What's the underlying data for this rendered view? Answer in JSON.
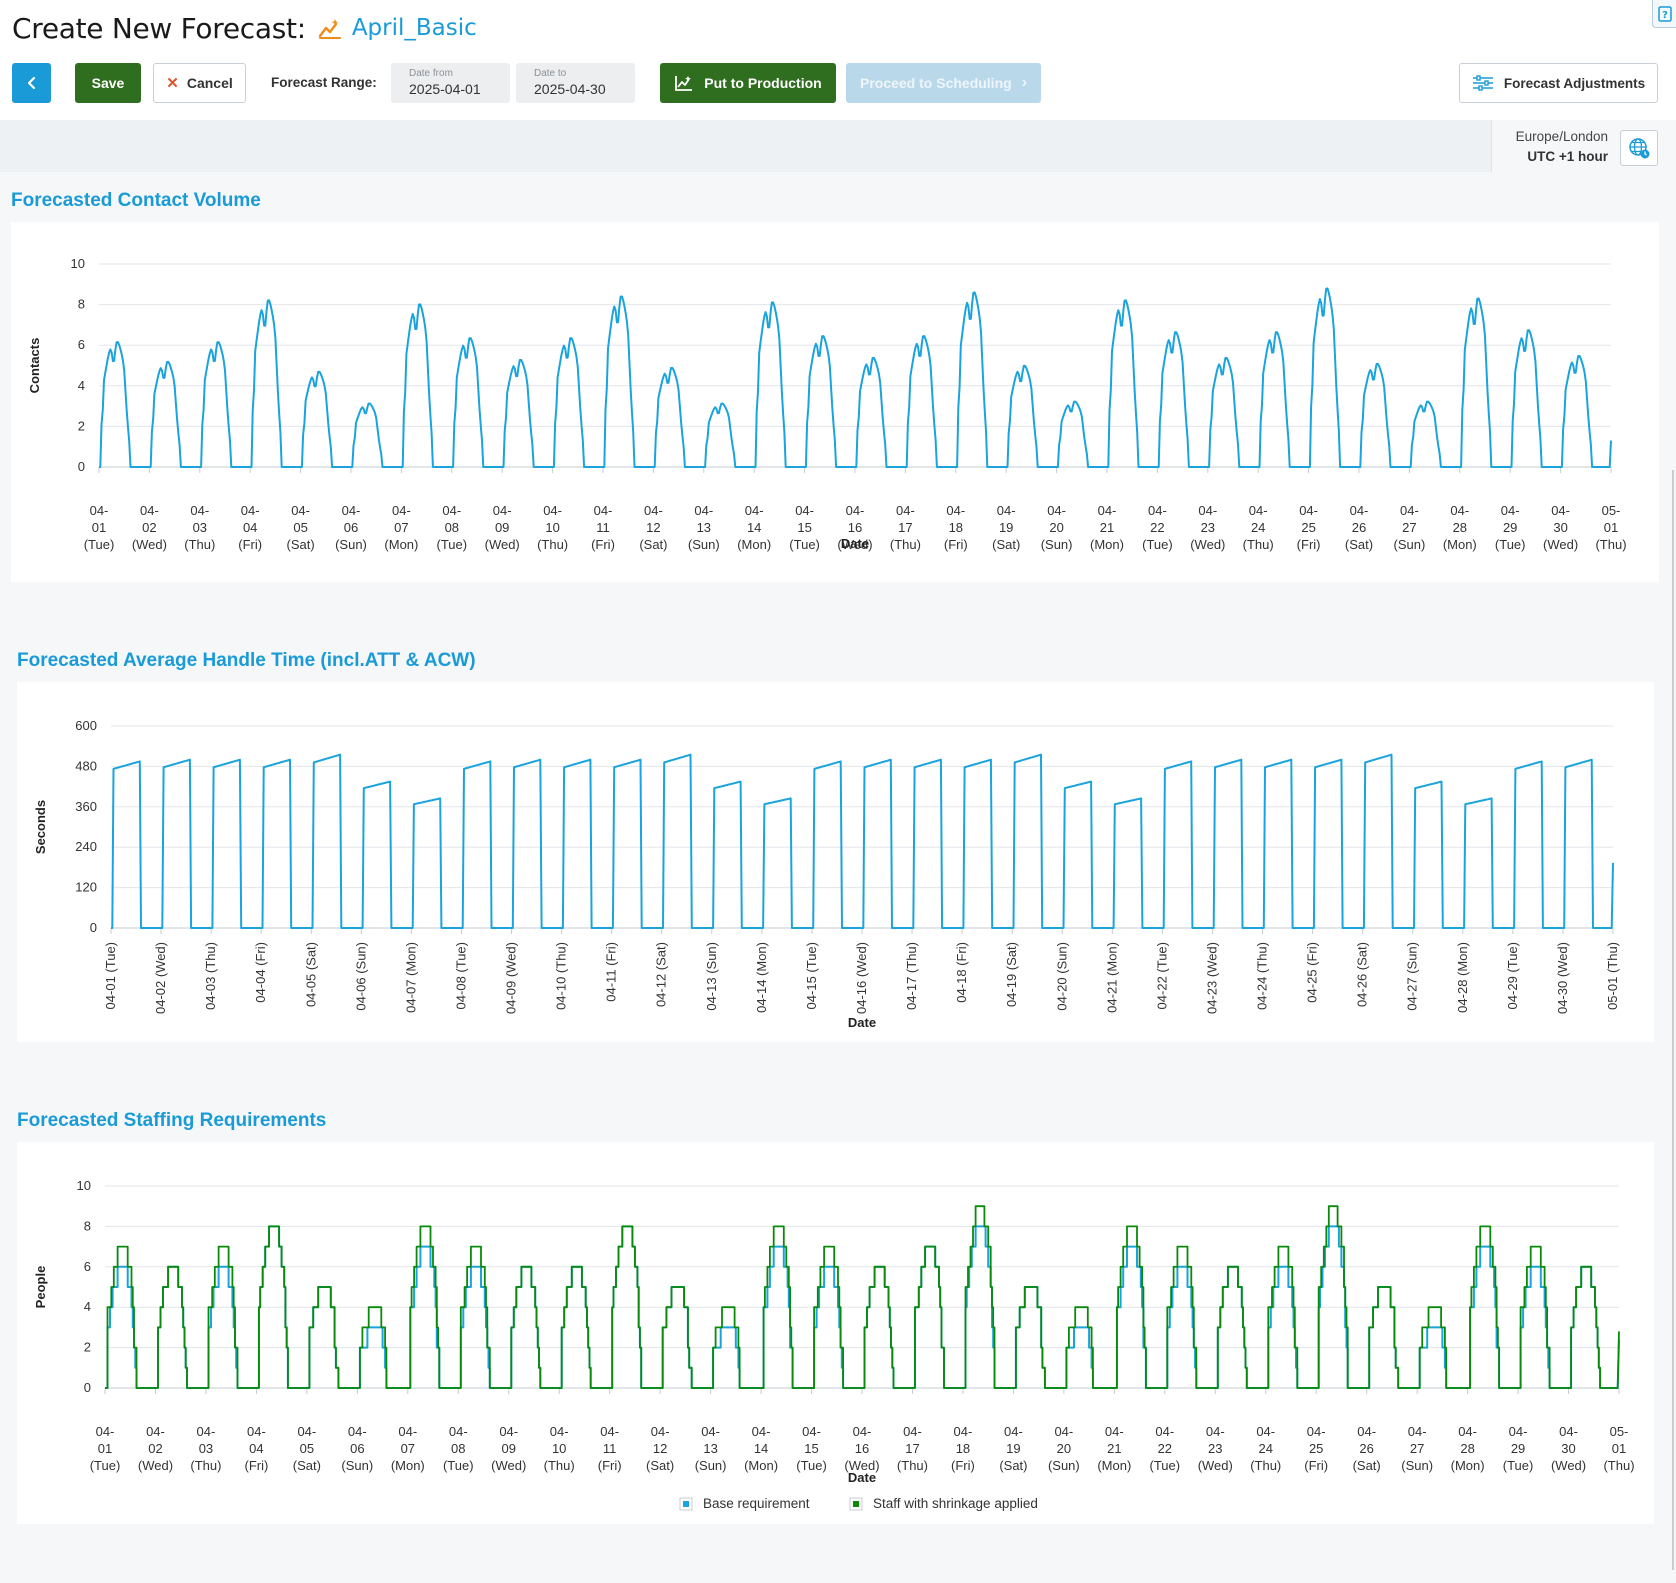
{
  "header": {
    "title": "Create New Forecast:",
    "forecast_name": "April_Basic",
    "icons": {
      "forecast": "chart-wand-icon",
      "help": "help-book-icon"
    }
  },
  "toolbar": {
    "save_label": "Save",
    "cancel_label": "Cancel",
    "range_label": "Forecast Range:",
    "date_from_label": "Date from",
    "date_from_value": "2025-04-01",
    "date_to_label": "Date to",
    "date_to_value": "2025-04-30",
    "production_label": "Put to Production",
    "scheduling_label": "Proceed to Scheduling",
    "adjustments_label": "Forecast Adjustments"
  },
  "timezone": {
    "name": "Europe/London",
    "offset": "UTC +1 hour"
  },
  "colors": {
    "accent": "#1a9bd7",
    "primary_green": "#2f6e1f",
    "series_blue": "#1aa3dc",
    "series_green": "#0a8a0a"
  },
  "dates": [
    {
      "d": "04-01",
      "w": "Tue"
    },
    {
      "d": "04-02",
      "w": "Wed"
    },
    {
      "d": "04-03",
      "w": "Thu"
    },
    {
      "d": "04-04",
      "w": "Fri"
    },
    {
      "d": "04-05",
      "w": "Sat"
    },
    {
      "d": "04-06",
      "w": "Sun"
    },
    {
      "d": "04-07",
      "w": "Mon"
    },
    {
      "d": "04-08",
      "w": "Tue"
    },
    {
      "d": "04-09",
      "w": "Wed"
    },
    {
      "d": "04-10",
      "w": "Thu"
    },
    {
      "d": "04-11",
      "w": "Fri"
    },
    {
      "d": "04-12",
      "w": "Sat"
    },
    {
      "d": "04-13",
      "w": "Sun"
    },
    {
      "d": "04-14",
      "w": "Mon"
    },
    {
      "d": "04-15",
      "w": "Tue"
    },
    {
      "d": "04-16",
      "w": "Wed"
    },
    {
      "d": "04-17",
      "w": "Thu"
    },
    {
      "d": "04-18",
      "w": "Fri"
    },
    {
      "d": "04-19",
      "w": "Sat"
    },
    {
      "d": "04-20",
      "w": "Sun"
    },
    {
      "d": "04-21",
      "w": "Mon"
    },
    {
      "d": "04-22",
      "w": "Tue"
    },
    {
      "d": "04-23",
      "w": "Wed"
    },
    {
      "d": "04-24",
      "w": "Thu"
    },
    {
      "d": "04-25",
      "w": "Fri"
    },
    {
      "d": "04-26",
      "w": "Sat"
    },
    {
      "d": "04-27",
      "w": "Sun"
    },
    {
      "d": "04-28",
      "w": "Mon"
    },
    {
      "d": "04-29",
      "w": "Tue"
    },
    {
      "d": "04-30",
      "w": "Wed"
    },
    {
      "d": "05-01",
      "w": "Thu"
    }
  ],
  "chart_data": [
    {
      "type": "line",
      "title": "Forecasted Contact Volume",
      "xlabel": "Date",
      "ylabel": "Contacts",
      "ylim": [
        0,
        10
      ],
      "yticks": [
        0,
        2,
        4,
        6,
        8,
        10
      ],
      "tick_style": "stacked",
      "grid": true,
      "series": [
        {
          "values": [
            6.3,
            5.3,
            6.3,
            8.4,
            4.8,
            3.2,
            8.2,
            6.5,
            5.4,
            6.5,
            8.6,
            5.0,
            3.2,
            8.3,
            6.6,
            5.5,
            6.6,
            8.8,
            5.1,
            3.3,
            8.4,
            6.8,
            5.5,
            6.8,
            9.0,
            5.2,
            3.3,
            8.5,
            6.9,
            5.6
          ]
        }
      ]
    },
    {
      "type": "line",
      "title": "Forecasted Average Handle Time (incl.ATT & ACW)",
      "xlabel": "Date",
      "ylabel": "Seconds",
      "ylim": [
        0,
        600
      ],
      "yticks": [
        0,
        120,
        240,
        360,
        480,
        600
      ],
      "tick_style": "rotated",
      "grid": true,
      "series": [
        {
          "values": [
            495,
            500,
            500,
            500,
            515,
            435,
            385,
            495,
            500,
            500,
            500,
            515,
            435,
            385,
            495,
            500,
            500,
            500,
            515,
            435,
            385,
            495,
            500,
            500,
            500,
            515,
            435,
            385,
            495,
            500
          ]
        }
      ]
    },
    {
      "type": "line",
      "title": "Forecasted Staffing Requirements",
      "xlabel": "Date",
      "ylabel": "People",
      "ylim": [
        0,
        10
      ],
      "yticks": [
        0,
        2,
        4,
        6,
        8,
        10
      ],
      "tick_style": "stacked",
      "grid": true,
      "legend": "bottom",
      "series": [
        {
          "name": "Base requirement",
          "values": [
            6,
            6,
            6,
            8,
            5,
            3,
            7,
            6,
            6,
            6,
            8,
            5,
            3,
            7,
            6,
            6,
            7,
            8,
            5,
            3,
            7,
            6,
            6,
            6,
            8,
            5,
            3,
            7,
            6,
            6
          ]
        },
        {
          "name": "Staff with shrinkage applied",
          "values": [
            7,
            6,
            7,
            8,
            5,
            4,
            8,
            7,
            6,
            6,
            8,
            5,
            4,
            8,
            7,
            6,
            7,
            9,
            5,
            4,
            8,
            7,
            6,
            7,
            9,
            5,
            4,
            8,
            7,
            6
          ]
        }
      ]
    }
  ]
}
